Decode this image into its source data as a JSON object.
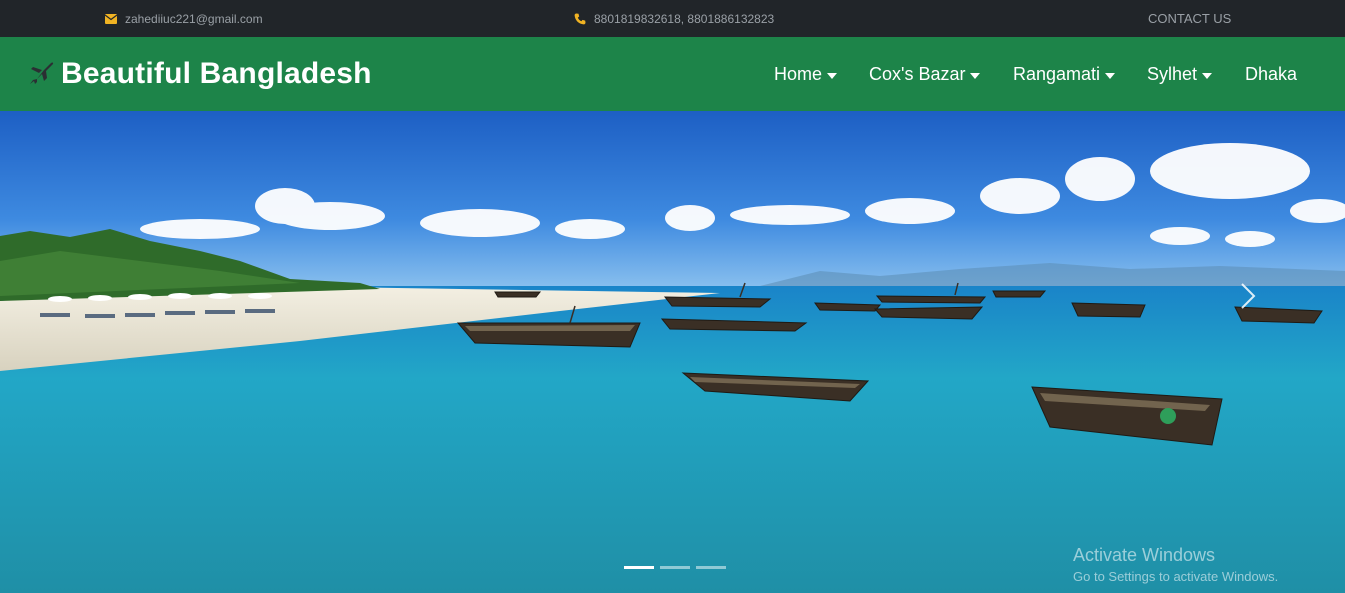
{
  "topbar": {
    "email": "zahediiuc221@gmail.com",
    "phone": "8801819832618, 8801886132823",
    "contact": "CONTACT US",
    "icon_color": "#f0b323"
  },
  "navbar": {
    "brand": "Beautiful Bangladesh",
    "brand_icon": "airplane-icon",
    "items": [
      {
        "label": "Home",
        "dropdown": true
      },
      {
        "label": "Cox's Bazar",
        "dropdown": true
      },
      {
        "label": "Rangamati",
        "dropdown": true
      },
      {
        "label": "Sylhet",
        "dropdown": true
      },
      {
        "label": "Dhaka",
        "dropdown": false
      }
    ],
    "background": "#1d8449"
  },
  "carousel": {
    "slide_image": "beach-with-boats-photo",
    "slide_count": 3,
    "active_slide": 1
  },
  "watermark": {
    "line1": "Activate Windows",
    "line2": "Go to Settings to activate Windows."
  }
}
